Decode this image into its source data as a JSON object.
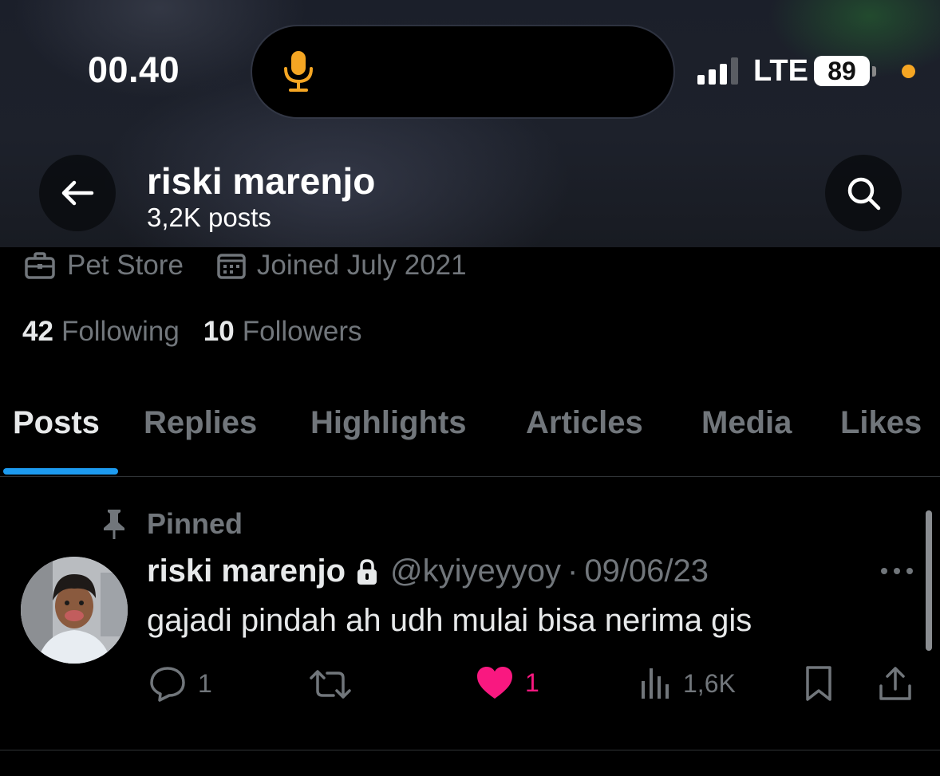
{
  "status_bar": {
    "time": "00.40",
    "network": "LTE",
    "battery": "89",
    "icons": [
      "microphone-icon",
      "signal-icon",
      "battery-icon",
      "privacy-dot"
    ],
    "colors": {
      "mic": "#f5a623",
      "privacy_dot": "#f5a623"
    }
  },
  "header": {
    "name": "riski marenjo",
    "posts": "3,2K posts",
    "back_icon": "arrow-left-icon",
    "search_icon": "search-icon"
  },
  "profile": {
    "category": "Pet Store",
    "joined": "Joined July 2021",
    "following_count": "42",
    "following_label": "Following",
    "followers_count": "10",
    "followers_label": "Followers"
  },
  "tabs": [
    {
      "label": "Posts",
      "active": true
    },
    {
      "label": "Replies"
    },
    {
      "label": "Highlights"
    },
    {
      "label": "Articles"
    },
    {
      "label": "Media"
    },
    {
      "label": "Likes"
    }
  ],
  "tweet": {
    "pinned_label": "Pinned",
    "name": "riski marenjo",
    "handle": "@kyiyeyyoy",
    "separator": "·",
    "date": "09/06/23",
    "text": "gajadi pindah ah udh mulai bisa nerima gis",
    "reply_count": "1",
    "like_count": "1",
    "view_count": "1,6K",
    "like_color": "#f91880"
  },
  "accent": "#1d9bf0"
}
